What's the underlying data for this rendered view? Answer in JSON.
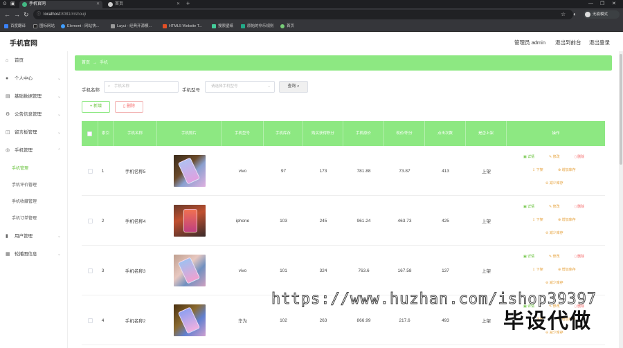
{
  "browser": {
    "tabs": [
      {
        "title": "手机官网",
        "active": true
      },
      {
        "title": "首页",
        "active": false
      }
    ],
    "url_host": "localhost",
    "url_path": ":8081/#/shouji",
    "profile_label": "无痕模式",
    "bookmarks": [
      "百度翻译",
      "图标网站",
      "Element - 网站快...",
      "Layui - 经典开源模...",
      "HTML5 Website T...",
      "搜索壁纸",
      "原始的非乐规则",
      "首页"
    ]
  },
  "app": {
    "brand": "手机官网",
    "admin": "管理员 admin",
    "back_front": "退出到前台",
    "logout": "退出登录"
  },
  "sidebar": {
    "items": [
      {
        "label": "首页",
        "icon": "home-icon"
      },
      {
        "label": "个人中心",
        "icon": "user-icon"
      },
      {
        "label": "基础数据管理",
        "icon": "folder-icon"
      },
      {
        "label": "公告信息管理",
        "icon": "gear-icon"
      },
      {
        "label": "留言板管理",
        "icon": "message-icon"
      },
      {
        "label": "手机管理",
        "icon": "phone-icon"
      },
      {
        "label": "用户管理",
        "icon": "chart-icon"
      },
      {
        "label": "轮播图信息",
        "icon": "grid-icon"
      }
    ],
    "subitems": [
      "手机管理",
      "手机评价管理",
      "手机收藏管理",
      "手机订单管理"
    ]
  },
  "breadcrumb": {
    "home": "首页",
    "current": "手机"
  },
  "filters": {
    "name_label": "手机名称",
    "name_placeholder": "手机名称",
    "type_label": "手机型号",
    "type_placeholder": "请选择手机型号",
    "search_label": "查询"
  },
  "actions": {
    "add": "新增",
    "delete": "删除"
  },
  "table": {
    "headers": [
      "索引",
      "手机名称",
      "手机照片",
      "手机型号",
      "手机库存",
      "购买获得积分",
      "手机原价",
      "现价/积分",
      "点击次数",
      "是否上架",
      "操作"
    ],
    "rows": [
      {
        "index": "1",
        "name": "手机名称5",
        "type": "vivo",
        "stock": "97",
        "points": "173",
        "price": "781.88",
        "now": "73.87",
        "clicks": "413",
        "status": "上架"
      },
      {
        "index": "2",
        "name": "手机名称4",
        "type": "iphone",
        "stock": "103",
        "points": "245",
        "price": "961.24",
        "now": "463.73",
        "clicks": "425",
        "status": "上架"
      },
      {
        "index": "3",
        "name": "手机名称3",
        "type": "vivo",
        "stock": "101",
        "points": "324",
        "price": "763.6",
        "now": "167.58",
        "clicks": "137",
        "status": "上架"
      },
      {
        "index": "4",
        "name": "手机名称2",
        "type": "华为",
        "stock": "102",
        "points": "263",
        "price": "866.99",
        "now": "217.6",
        "clicks": "493",
        "status": "上架"
      }
    ],
    "ops": {
      "detail": "详情",
      "edit": "修改",
      "remove": "删除",
      "off": "下架",
      "stock": "增加库存",
      "less": "减少库存"
    }
  },
  "watermark": {
    "url": "https://www.huzhan.com/ishop39397",
    "text": "毕设代做"
  },
  "colors": {
    "accent": "#8de882",
    "green": "#67c23a",
    "orange": "#e6a23c",
    "red": "#f56c6c"
  }
}
